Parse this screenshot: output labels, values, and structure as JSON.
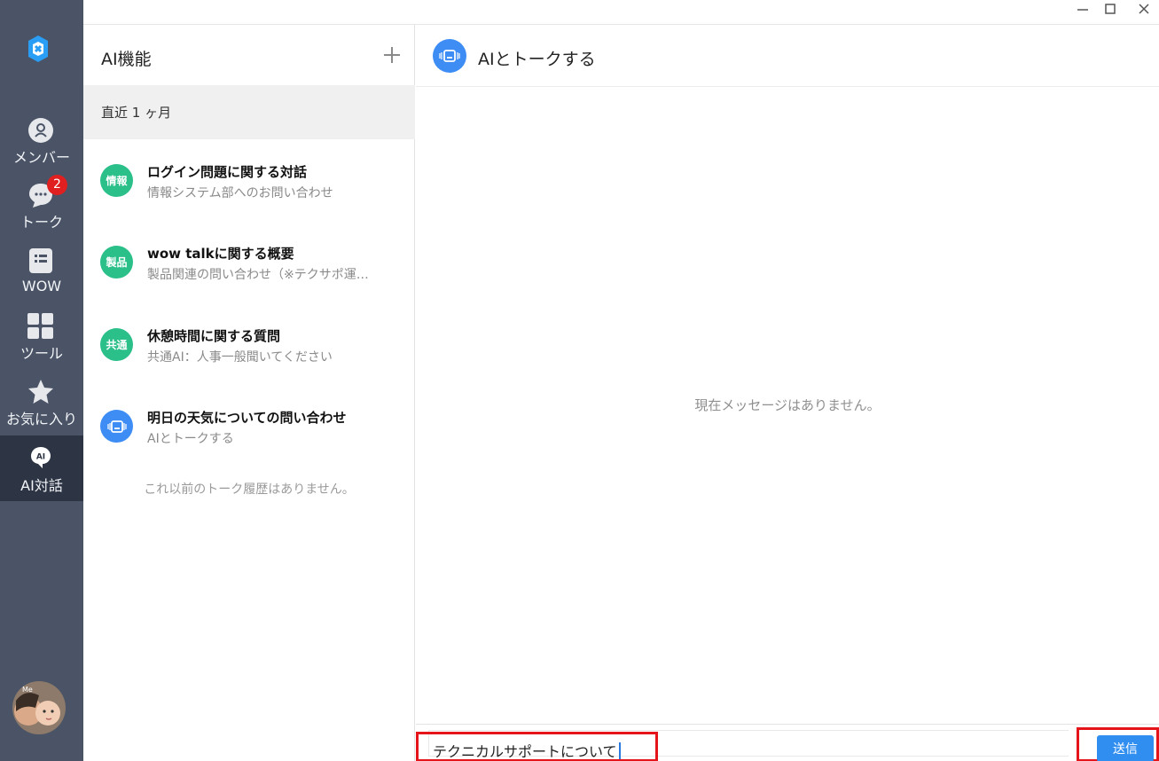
{
  "window": {
    "controls": [
      {
        "icon": "minimize-icon",
        "glyph": "—"
      },
      {
        "icon": "maximize-icon",
        "glyph": "☐"
      },
      {
        "icon": "close-icon",
        "glyph": "✕"
      }
    ]
  },
  "sidebar": {
    "logo_icon": "app-logo-icon",
    "items": [
      {
        "label": "メンバー",
        "icon": "member-icon"
      },
      {
        "label": "トーク",
        "icon": "talk-icon",
        "badge": "2"
      },
      {
        "label": "WOW",
        "icon": "wow-icon"
      },
      {
        "label": "ツール",
        "icon": "tools-grid-icon"
      },
      {
        "label": "お気に入り",
        "icon": "star-icon"
      },
      {
        "label": "AI対話",
        "icon": "ai-chat-icon",
        "active": true,
        "icon_text": "AI"
      }
    ],
    "avatar_text": "Me"
  },
  "list_panel": {
    "title": "AI機能",
    "add_icon": "plus-icon",
    "section": "直近 1 ヶ月",
    "conversations": [
      {
        "badge": "情報",
        "badge_color": "#2bbf8a",
        "title": "ログイン問題に関する対話",
        "subtitle": "情報システム部へのお問い合わせ"
      },
      {
        "badge": "製品",
        "badge_color": "#2bbf8a",
        "title": "wow talkに関する概要",
        "subtitle": "製品関連の問い合わせ（※テクサポ運…"
      },
      {
        "badge": "共通",
        "badge_color": "#2bbf8a",
        "title": "休憩時間に関する質問",
        "subtitle": "共通AI：人事一般聞いてください"
      },
      {
        "badge_icon": "ai-robot-icon",
        "badge_color": "#3d8df5",
        "title": "明日の天気についての問い合わせ",
        "subtitle": "AIとトークする"
      }
    ],
    "end_note": "これ以前のトーク履歴はありません。"
  },
  "chat": {
    "title": "AIとトークする",
    "header_icon": "ai-robot-icon",
    "empty_message": "現在メッセージはありません。",
    "input_value": "テクニカルサポートについて",
    "send_label": "送信"
  },
  "colors": {
    "rail": "#4a5466",
    "rail_active": "#2d3444",
    "accent": "#2f8ef0",
    "highlight": "#e5141b",
    "badge_green": "#2bbf8a"
  }
}
